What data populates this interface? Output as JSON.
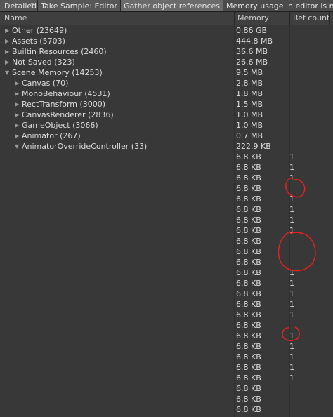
{
  "toolbar": {
    "mode_label": "Detailed",
    "mode_arrow": "▾",
    "take_sample_label": "Take Sample: Editor",
    "gather_refs_label": "Gather object references",
    "message": "Memory usage in editor is not as it wi"
  },
  "columns": {
    "name": "Name",
    "memory": "Memory",
    "ref_count": "Ref count"
  },
  "rows": [
    {
      "name": "Other (23649)",
      "memory": "0.86 GB",
      "ref": "",
      "depth": 0,
      "expander": "collapsed"
    },
    {
      "name": "Assets (5703)",
      "memory": "444.8 MB",
      "ref": "",
      "depth": 0,
      "expander": "collapsed"
    },
    {
      "name": "Builtin Resources (2460)",
      "memory": "36.6 MB",
      "ref": "",
      "depth": 0,
      "expander": "collapsed"
    },
    {
      "name": "Not Saved (323)",
      "memory": "26.6 MB",
      "ref": "",
      "depth": 0,
      "expander": "collapsed"
    },
    {
      "name": "Scene Memory (14253)",
      "memory": "9.5 MB",
      "ref": "",
      "depth": 0,
      "expander": "expanded"
    },
    {
      "name": "Canvas (70)",
      "memory": "2.8 MB",
      "ref": "",
      "depth": 1,
      "expander": "collapsed"
    },
    {
      "name": "MonoBehaviour (4531)",
      "memory": "1.8 MB",
      "ref": "",
      "depth": 1,
      "expander": "collapsed"
    },
    {
      "name": "RectTransform (3000)",
      "memory": "1.5 MB",
      "ref": "",
      "depth": 1,
      "expander": "collapsed"
    },
    {
      "name": "CanvasRenderer (2836)",
      "memory": "1.0 MB",
      "ref": "",
      "depth": 1,
      "expander": "collapsed"
    },
    {
      "name": "GameObject (3066)",
      "memory": "1.0 MB",
      "ref": "",
      "depth": 1,
      "expander": "collapsed"
    },
    {
      "name": "Animator (267)",
      "memory": "0.7 MB",
      "ref": "",
      "depth": 1,
      "expander": "collapsed"
    },
    {
      "name": "AnimatorOverrideController (33)",
      "memory": "222.9 KB",
      "ref": "",
      "depth": 1,
      "expander": "expanded"
    },
    {
      "name": "",
      "memory": "6.8 KB",
      "ref": "1",
      "depth": 2,
      "expander": "none"
    },
    {
      "name": "",
      "memory": "6.8 KB",
      "ref": "1",
      "depth": 2,
      "expander": "none"
    },
    {
      "name": "",
      "memory": "6.8 KB",
      "ref": "1",
      "depth": 2,
      "expander": "none"
    },
    {
      "name": "",
      "memory": "6.8 KB",
      "ref": "",
      "depth": 2,
      "expander": "none"
    },
    {
      "name": "",
      "memory": "6.8 KB",
      "ref": "1",
      "depth": 2,
      "expander": "none"
    },
    {
      "name": "",
      "memory": "6.8 KB",
      "ref": "1",
      "depth": 2,
      "expander": "none"
    },
    {
      "name": "",
      "memory": "6.8 KB",
      "ref": "1",
      "depth": 2,
      "expander": "none"
    },
    {
      "name": "",
      "memory": "6.8 KB",
      "ref": "1",
      "depth": 2,
      "expander": "none"
    },
    {
      "name": "",
      "memory": "6.8 KB",
      "ref": "",
      "depth": 2,
      "expander": "none"
    },
    {
      "name": "",
      "memory": "6.8 KB",
      "ref": "",
      "depth": 2,
      "expander": "none"
    },
    {
      "name": "",
      "memory": "6.8 KB",
      "ref": "",
      "depth": 2,
      "expander": "none"
    },
    {
      "name": "",
      "memory": "6.8 KB",
      "ref": "1",
      "depth": 2,
      "expander": "none"
    },
    {
      "name": "",
      "memory": "6.8 KB",
      "ref": "1",
      "depth": 2,
      "expander": "none"
    },
    {
      "name": "",
      "memory": "6.8 KB",
      "ref": "1",
      "depth": 2,
      "expander": "none"
    },
    {
      "name": "",
      "memory": "6.8 KB",
      "ref": "1",
      "depth": 2,
      "expander": "none"
    },
    {
      "name": "",
      "memory": "6.8 KB",
      "ref": "1",
      "depth": 2,
      "expander": "none"
    },
    {
      "name": "",
      "memory": "6.8 KB",
      "ref": "",
      "depth": 2,
      "expander": "none"
    },
    {
      "name": "",
      "memory": "6.8 KB",
      "ref": "1",
      "depth": 2,
      "expander": "none"
    },
    {
      "name": "",
      "memory": "6.8 KB",
      "ref": "1",
      "depth": 2,
      "expander": "none"
    },
    {
      "name": "",
      "memory": "6.8 KB",
      "ref": "1",
      "depth": 2,
      "expander": "none"
    },
    {
      "name": "",
      "memory": "6.8 KB",
      "ref": "1",
      "depth": 2,
      "expander": "none"
    },
    {
      "name": "",
      "memory": "6.8 KB",
      "ref": "1",
      "depth": 2,
      "expander": "none"
    },
    {
      "name": "",
      "memory": "6.8 KB",
      "ref": "",
      "depth": 2,
      "expander": "none"
    },
    {
      "name": "",
      "memory": "6.8 KB",
      "ref": "",
      "depth": 2,
      "expander": "none"
    },
    {
      "name": "",
      "memory": "6.8 KB",
      "ref": "",
      "depth": 2,
      "expander": "none"
    }
  ],
  "colors": {
    "background": "#383838",
    "text": "#dcdcdc",
    "annotation": "#e8201c"
  }
}
